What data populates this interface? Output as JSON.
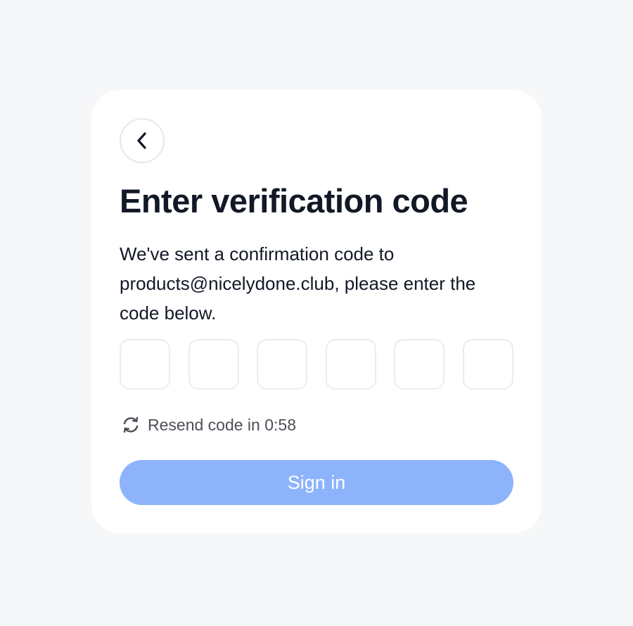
{
  "header": {
    "back_icon": "chevron-left-icon"
  },
  "main": {
    "title": "Enter verification code",
    "description": "We've sent a confirmation code to products@nicelydone.club, please enter the code below.",
    "code_digits": [
      "",
      "",
      "",
      "",
      "",
      ""
    ],
    "resend_icon": "refresh-icon",
    "resend_text": "Resend code in 0:58",
    "signin_label": "Sign in"
  },
  "colors": {
    "background": "#f6f7f9",
    "card": "#ffffff",
    "title": "#121826",
    "button_disabled": "#8db3fb",
    "button_text": "#ffffff",
    "muted_text": "#4b4f58"
  }
}
